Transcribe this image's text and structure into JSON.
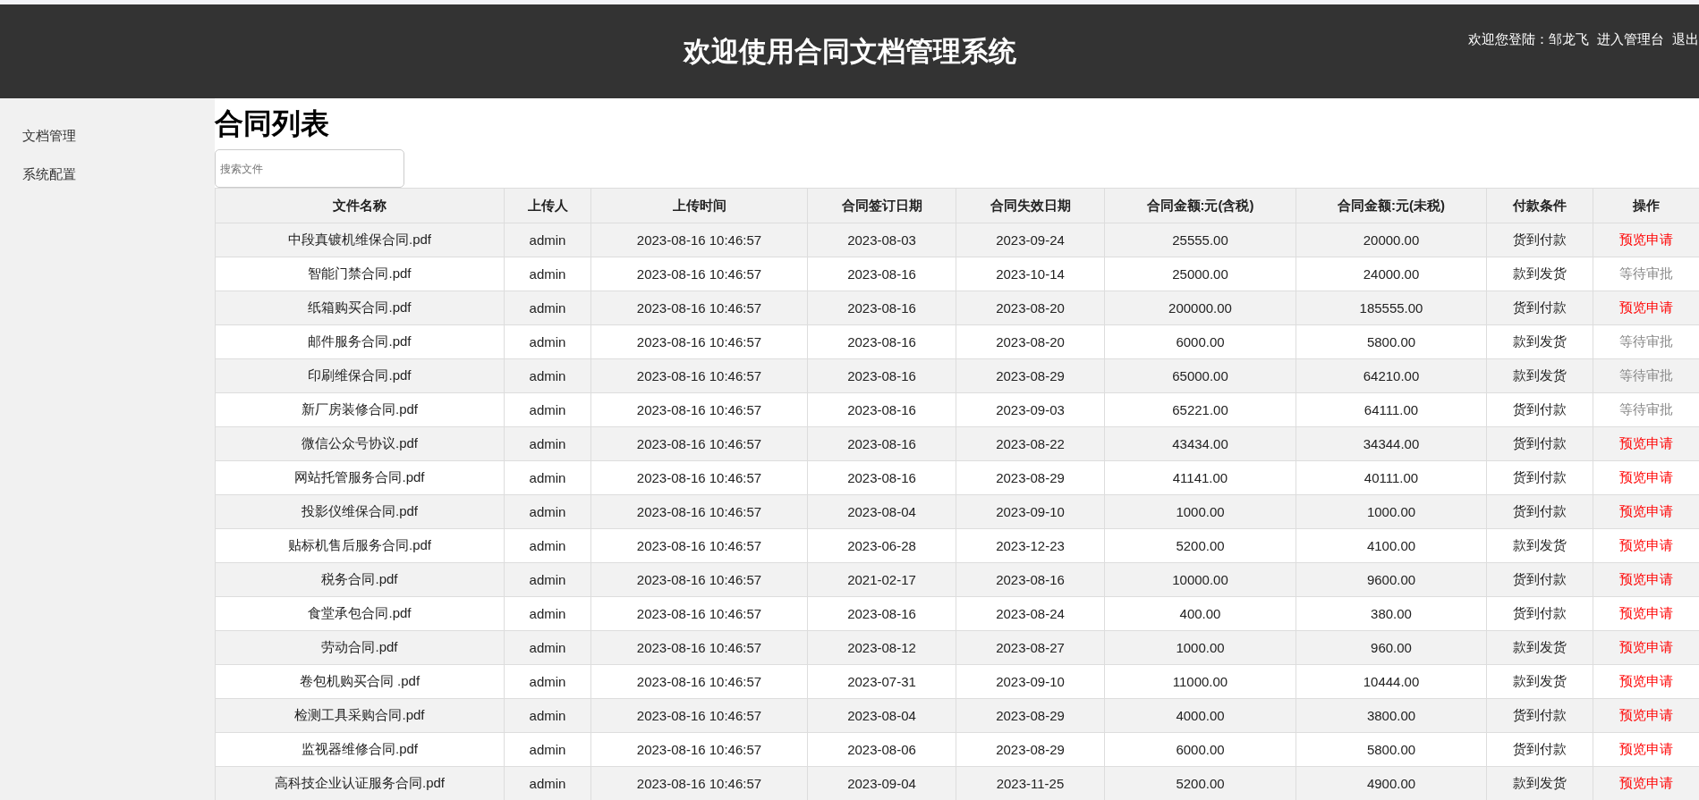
{
  "header": {
    "title": "欢迎使用合同文档管理系统",
    "welcome": "欢迎您登陆：邹龙飞",
    "links": [
      "进入管理台",
      "退出"
    ]
  },
  "sidebar": {
    "items": [
      {
        "label": "文档管理"
      },
      {
        "label": "系统配置"
      }
    ]
  },
  "page_title": "合同列表",
  "search": {
    "placeholder": "搜索文件"
  },
  "table": {
    "columns": [
      "文件名称",
      "上传人",
      "上传时间",
      "合同签订日期",
      "合同失效日期",
      "合同金额:元(含税)",
      "合同金额:元(未税)",
      "付款条件",
      "操作"
    ],
    "rows": [
      {
        "cells": [
          "中段真镀机维保合同.pdf",
          "admin",
          "2023-08-16 10:46:57",
          "2023-08-03",
          "2023-09-24",
          "25555.00",
          "20000.00",
          "货到付款"
        ],
        "action": {
          "kind": "preview",
          "label": "预览申请"
        }
      },
      {
        "cells": [
          "智能门禁合同.pdf",
          "admin",
          "2023-08-16 10:46:57",
          "2023-08-16",
          "2023-10-14",
          "25000.00",
          "24000.00",
          "款到发货"
        ],
        "action": {
          "kind": "pending",
          "label": "等待审批"
        }
      },
      {
        "cells": [
          "纸箱购买合同.pdf",
          "admin",
          "2023-08-16 10:46:57",
          "2023-08-16",
          "2023-08-20",
          "200000.00",
          "185555.00",
          "货到付款"
        ],
        "action": {
          "kind": "preview",
          "label": "预览申请"
        }
      },
      {
        "cells": [
          "邮件服务合同.pdf",
          "admin",
          "2023-08-16 10:46:57",
          "2023-08-16",
          "2023-08-20",
          "6000.00",
          "5800.00",
          "款到发货"
        ],
        "action": {
          "kind": "pending",
          "label": "等待审批"
        }
      },
      {
        "cells": [
          "印刷维保合同.pdf",
          "admin",
          "2023-08-16 10:46:57",
          "2023-08-16",
          "2023-08-29",
          "65000.00",
          "64210.00",
          "款到发货"
        ],
        "action": {
          "kind": "pending",
          "label": "等待审批"
        }
      },
      {
        "cells": [
          "新厂房装修合同.pdf",
          "admin",
          "2023-08-16 10:46:57",
          "2023-08-16",
          "2023-09-03",
          "65221.00",
          "64111.00",
          "货到付款"
        ],
        "action": {
          "kind": "pending",
          "label": "等待审批"
        }
      },
      {
        "cells": [
          "微信公众号协议.pdf",
          "admin",
          "2023-08-16 10:46:57",
          "2023-08-16",
          "2023-08-22",
          "43434.00",
          "34344.00",
          "货到付款"
        ],
        "action": {
          "kind": "preview",
          "label": "预览申请"
        }
      },
      {
        "cells": [
          "网站托管服务合同.pdf",
          "admin",
          "2023-08-16 10:46:57",
          "2023-08-16",
          "2023-08-29",
          "41141.00",
          "40111.00",
          "货到付款"
        ],
        "action": {
          "kind": "preview",
          "label": "预览申请"
        }
      },
      {
        "cells": [
          "投影仪维保合同.pdf",
          "admin",
          "2023-08-16 10:46:57",
          "2023-08-04",
          "2023-09-10",
          "1000.00",
          "1000.00",
          "货到付款"
        ],
        "action": {
          "kind": "preview",
          "label": "预览申请"
        }
      },
      {
        "cells": [
          "贴标机售后服务合同.pdf",
          "admin",
          "2023-08-16 10:46:57",
          "2023-06-28",
          "2023-12-23",
          "5200.00",
          "4100.00",
          "款到发货"
        ],
        "action": {
          "kind": "preview",
          "label": "预览申请"
        }
      },
      {
        "cells": [
          "税务合同.pdf",
          "admin",
          "2023-08-16 10:46:57",
          "2021-02-17",
          "2023-08-16",
          "10000.00",
          "9600.00",
          "货到付款"
        ],
        "action": {
          "kind": "preview",
          "label": "预览申请"
        }
      },
      {
        "cells": [
          "食堂承包合同.pdf",
          "admin",
          "2023-08-16 10:46:57",
          "2023-08-16",
          "2023-08-24",
          "400.00",
          "380.00",
          "货到付款"
        ],
        "action": {
          "kind": "preview",
          "label": "预览申请"
        }
      },
      {
        "cells": [
          "劳动合同.pdf",
          "admin",
          "2023-08-16 10:46:57",
          "2023-08-12",
          "2023-08-27",
          "1000.00",
          "960.00",
          "款到发货"
        ],
        "action": {
          "kind": "preview",
          "label": "预览申请"
        }
      },
      {
        "cells": [
          "卷包机购买合同 .pdf",
          "admin",
          "2023-08-16 10:46:57",
          "2023-07-31",
          "2023-09-10",
          "11000.00",
          "10444.00",
          "款到发货"
        ],
        "action": {
          "kind": "preview",
          "label": "预览申请"
        }
      },
      {
        "cells": [
          "检测工具采购合同.pdf",
          "admin",
          "2023-08-16 10:46:57",
          "2023-08-04",
          "2023-08-29",
          "4000.00",
          "3800.00",
          "货到付款"
        ],
        "action": {
          "kind": "preview",
          "label": "预览申请"
        }
      },
      {
        "cells": [
          "监视器维修合同.pdf",
          "admin",
          "2023-08-16 10:46:57",
          "2023-08-06",
          "2023-08-29",
          "6000.00",
          "5800.00",
          "货到付款"
        ],
        "action": {
          "kind": "preview",
          "label": "预览申请"
        }
      },
      {
        "cells": [
          "高科技企业认证服务合同.pdf",
          "admin",
          "2023-08-16 10:46:57",
          "2023-09-04",
          "2023-11-25",
          "5200.00",
          "4900.00",
          "款到发货"
        ],
        "action": {
          "kind": "preview",
          "label": "预览申请"
        }
      }
    ]
  }
}
